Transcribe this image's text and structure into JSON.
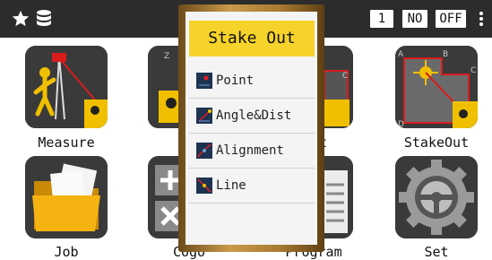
{
  "status": {
    "number": "1",
    "no": "NO",
    "off": "OFF"
  },
  "apps": [
    {
      "label": "Measure"
    },
    {
      "label": "St"
    },
    {
      "label": "ct"
    },
    {
      "label": "StakeOut"
    },
    {
      "label": "Job"
    },
    {
      "label": "Cogo"
    },
    {
      "label": "Program"
    },
    {
      "label": "Set"
    }
  ],
  "popup": {
    "title": "Stake Out",
    "items": [
      {
        "label": "Point"
      },
      {
        "label": "Angle&Dist"
      },
      {
        "label": "Alignment"
      },
      {
        "label": "Line"
      }
    ]
  },
  "colors": {
    "topbar": "#2c2c2c",
    "title_bg": "#f6d32a",
    "frame": "#b0813a",
    "tile": "#2f2f2f",
    "accent_red": "#d81c1c"
  }
}
